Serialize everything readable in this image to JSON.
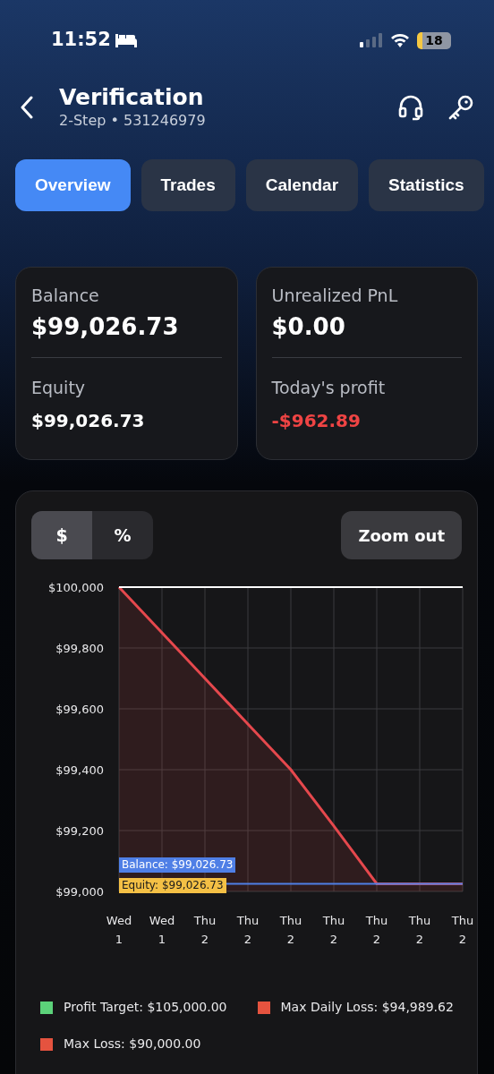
{
  "status_bar": {
    "time": "11:52",
    "battery": "18"
  },
  "header": {
    "title": "Verification",
    "subtitle": "2-Step • 531246979"
  },
  "tabs": [
    {
      "label": "Overview",
      "selected": true
    },
    {
      "label": "Trades",
      "selected": false
    },
    {
      "label": "Calendar",
      "selected": false
    },
    {
      "label": "Statistics",
      "selected": false
    }
  ],
  "stats": [
    {
      "label": "Balance",
      "value": "$99,026.73",
      "negative": false
    },
    {
      "label": "Unrealized PnL",
      "value": "$0.00",
      "negative": false
    },
    {
      "label": "Equity",
      "value": "$99,026.73",
      "negative": false
    },
    {
      "label": "Today's profit",
      "value": "-$962.89",
      "negative": true
    }
  ],
  "chart_panel": {
    "units": [
      {
        "label": "$",
        "selected": true
      },
      {
        "label": "%",
        "selected": false
      }
    ],
    "zoom_button": "Zoom out",
    "chart_data": {
      "type": "area",
      "grid": true,
      "categories": [
        "Wed 1",
        "Wed 1",
        "Thu 2",
        "Thu 2",
        "Thu 2",
        "Thu 2",
        "Thu 2",
        "Thu 2",
        "Thu 2"
      ],
      "ylim": [
        99000,
        100000
      ],
      "yticks": [
        {
          "value": 99000,
          "label": "$99,000"
        },
        {
          "value": 99200,
          "label": "$99,200"
        },
        {
          "value": 99400,
          "label": "$99,400"
        },
        {
          "value": 99600,
          "label": "$99,600"
        },
        {
          "value": 99800,
          "label": "$99,800"
        },
        {
          "value": 100000,
          "label": "$100,000"
        }
      ],
      "series": [
        {
          "color": "#e5484d",
          "values": [
            100000,
            99850,
            99700,
            99550,
            99400,
            99215,
            99025,
            99025,
            99025
          ]
        }
      ],
      "ref_lines": [
        {
          "axis": "y",
          "value": 100000,
          "color": "#ffffff"
        },
        {
          "axis": "y",
          "value": 99025,
          "color": "#4f7fe6"
        }
      ]
    },
    "value_tags": [
      {
        "text": "Balance: $99,026.73",
        "color": "#4f7fe6"
      },
      {
        "text": "Equity: $99,026.73",
        "color": "#f4c045"
      }
    ],
    "legend": [
      {
        "label": "Profit Target: $105,000.00",
        "color": "#5cd27a"
      },
      {
        "label": "Max Daily Loss: $94,989.62",
        "color": "#e5533f"
      },
      {
        "label": "Max Loss: $90,000.00",
        "color": "#e5533f"
      }
    ]
  }
}
